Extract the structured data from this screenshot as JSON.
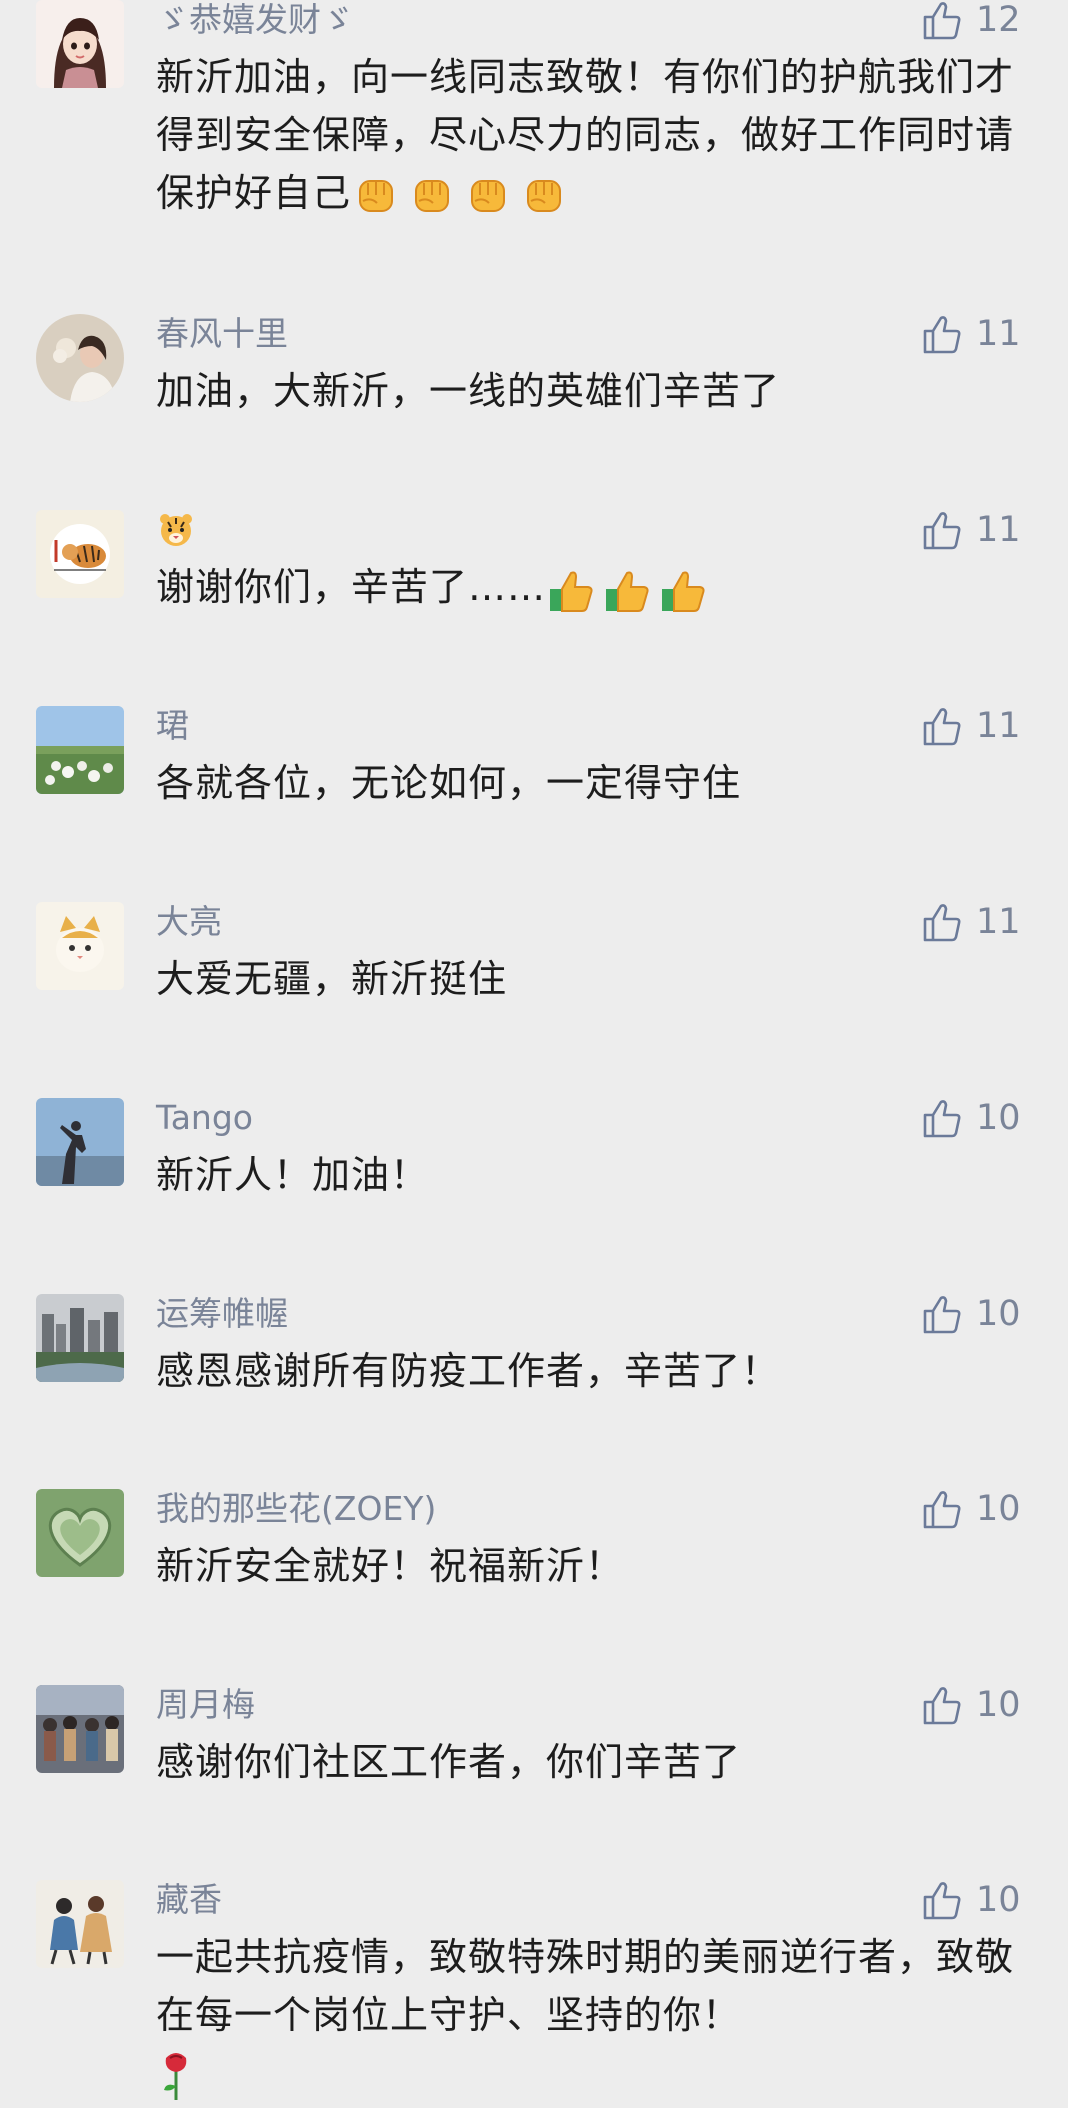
{
  "comments": [
    {
      "nickname": "ゞ恭嬉发财ゞ",
      "likes": "12",
      "avatar": "avatar-cartoon-girl",
      "text": "新沂加油，向一线同志致敬！有你们的护航我们才得到安全保障，尽心尽力的同志，做好工作同时请保护好自己",
      "emoji": "raised-fist-emoji",
      "emoji_count": 4
    },
    {
      "nickname": "春风十里",
      "likes": "11",
      "avatar": "avatar-woman-flowers",
      "text": "加油，大新沂，一线的英雄们辛苦了"
    },
    {
      "nickname": "",
      "name_icon": "tiger-face-icon",
      "likes": "11",
      "avatar": "avatar-tiger-painting",
      "text": "谢谢你们，辛苦了……",
      "emoji": "thumbs-up-emoji",
      "emoji_count": 3
    },
    {
      "nickname": "珺",
      "likes": "11",
      "avatar": "avatar-flower-field",
      "text": "各就各位，无论如何，一定得守住"
    },
    {
      "nickname": "大亮",
      "likes": "11",
      "avatar": "avatar-cat",
      "text": "大爱无疆，新沂挺住"
    },
    {
      "nickname": "Tango",
      "likes": "10",
      "avatar": "avatar-person-sky",
      "text": "新沂人！加油！"
    },
    {
      "nickname": "运筹帷幄",
      "likes": "10",
      "avatar": "avatar-city-skyline",
      "text": "感恩感谢所有防疫工作者，辛苦了！"
    },
    {
      "nickname": "我的那些花(ZOEY)",
      "likes": "10",
      "avatar": "avatar-green-heart",
      "text": "新沂安全就好！祝福新沂！"
    },
    {
      "nickname": "周月梅",
      "likes": "10",
      "avatar": "avatar-crowd",
      "text": "感谢你们社区工作者，你们辛苦了"
    },
    {
      "nickname": "藏香",
      "likes": "10",
      "avatar": "avatar-two-figures",
      "text": "一起共抗疫情，致敬特殊时期的美丽逆行者，致敬在每一个岗位上守护、坚持的你！",
      "emoji": "rose-emoji",
      "emoji_count": 1
    }
  ],
  "colors": {
    "background": "#ededed",
    "nickname": "#7a8498",
    "text": "#1d1d1d",
    "like_icon": "#6b7a99"
  }
}
